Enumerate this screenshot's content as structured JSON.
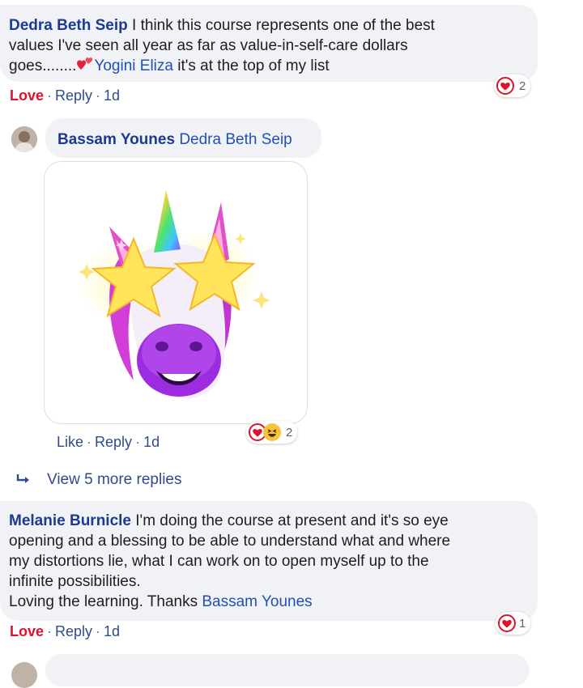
{
  "comments": [
    {
      "author": "Dedra Beth Seip",
      "text_line1": "I think this course represents one of the best",
      "text_line2": "values I've seen all year as far as value-in-self-care dollars",
      "text_line3_prefix": "goes........",
      "mention": "Yogini Eliza",
      "text_line3_suffix": "it's at the top of my list",
      "actions": {
        "love": "Love",
        "reply": "Reply",
        "time": "1d"
      },
      "reaction_count": "2"
    },
    {
      "author": "Bassam Younes",
      "mention": "Dedra Beth Seip",
      "actions": {
        "like": "Like",
        "reply": "Reply",
        "time": "1d"
      },
      "reaction_count": "2"
    },
    {
      "author": "Melanie Burnicle",
      "text_line1": "I'm doing the course at present and it's so eye",
      "text_line2": "opening and a blessing to be able to understand what and where",
      "text_line3": "my distortions lie, what I can work on to open myself up to the",
      "text_line4": "infinite possibilities.",
      "text_line5_prefix": "Loving the learning. Thanks",
      "mention": "Bassam Younes",
      "actions": {
        "love": "Love",
        "reply": "Reply",
        "time": "1d"
      },
      "reaction_count": "1"
    }
  ],
  "view_more": "View 5 more replies",
  "icons": {
    "reaction_love": "heart-icon",
    "reaction_haha": "laughing-face-icon",
    "reply_arrow": "reply-arrow-icon",
    "sticker": "unicorn-sticker"
  },
  "colors": {
    "bubble": "#f0f2f5",
    "name": "#1c3a8f",
    "love": "#e0112b",
    "link": "#2f4a8f"
  }
}
